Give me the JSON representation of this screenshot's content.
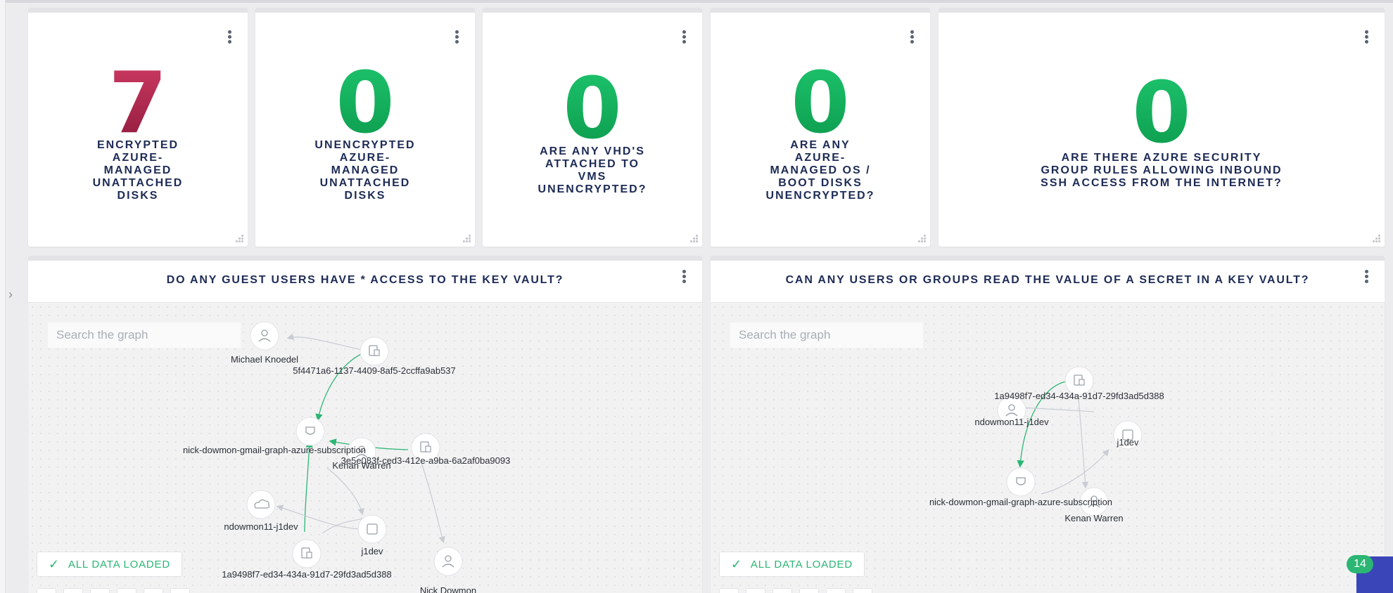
{
  "tiles": [
    {
      "value": "7",
      "label": "ENCRYPTED AZURE-MANAGED UNATTACHED DISKS",
      "status": "bad"
    },
    {
      "value": "0",
      "label": "UNENCRYPTED AZURE-MANAGED UNATTACHED DISKS",
      "status": "good"
    },
    {
      "value": "0",
      "label": "ARE ANY VHD'S ATTACHED TO VMS UNENCRYPTED?",
      "status": "good"
    },
    {
      "value": "0",
      "label": "ARE ANY AZURE-MANAGED OS / BOOT DISKS UNENCRYPTED?",
      "status": "good"
    },
    {
      "value": "0",
      "label": "ARE THERE AZURE SECURITY GROUP RULES ALLOWING INBOUND SSH ACCESS FROM THE INTERNET?",
      "status": "good"
    }
  ],
  "tile_label_lines": [
    [
      "ENCRYPTED",
      "AZURE-",
      "MANAGED",
      "UNATTACHED",
      "DISKS"
    ],
    [
      "UNENCRYPTED",
      "AZURE-",
      "MANAGED",
      "UNATTACHED",
      "DISKS"
    ],
    [
      "ARE ANY VHD'S",
      "ATTACHED TO",
      "VMS",
      "UNENCRYPTED?"
    ],
    [
      "ARE ANY",
      "AZURE-",
      "MANAGED OS /",
      "BOOT DISKS",
      "UNENCRYPTED?"
    ],
    [
      "ARE THERE AZURE SECURITY",
      "GROUP RULES ALLOWING INBOUND",
      "SSH ACCESS FROM THE INTERNET?"
    ]
  ],
  "panels": [
    {
      "title": "DO ANY GUEST USERS HAVE * ACCESS TO THE KEY VAULT?",
      "search_placeholder": "Search the graph",
      "status": "ALL DATA LOADED",
      "labels": {
        "michael": "Michael Knoedel",
        "id_5f": "5f4471a6-1137-4409-8af5-2ccffa9ab537",
        "sub": "nick-dowmon-gmail-graph-azure-subscription",
        "kenan": "Kenan Warren",
        "id_3e": "3e5e083f-ced3-412e-a9ba-6a2af0ba9093",
        "ndowmon": "ndowmon11-j1dev",
        "j1dev": "j1dev",
        "id_1a": "1a9498f7-ed34-434a-91d7-29fd3ad5d388",
        "nick": "Nick Dowmon"
      }
    },
    {
      "title": "CAN ANY USERS OR GROUPS READ THE VALUE OF A SECRET IN A KEY VAULT?",
      "search_placeholder": "Search the graph",
      "status": "ALL DATA LOADED",
      "labels": {
        "id_1a": "1a9498f7-ed34-434a-91d7-29fd3ad5d388",
        "ndowmon": "ndowmon11-j1dev",
        "j1dev": "j1dev",
        "sub": "nick-dowmon-gmail-graph-azure-subscription",
        "kenan": "Kenan Warren"
      }
    }
  ],
  "notification_count": "14",
  "colors": {
    "bad": "#b2214d",
    "good": "#12b05c",
    "title": "#1d2b55",
    "edge_green": "#2bb673",
    "edge_grey": "#c9ccd2"
  }
}
